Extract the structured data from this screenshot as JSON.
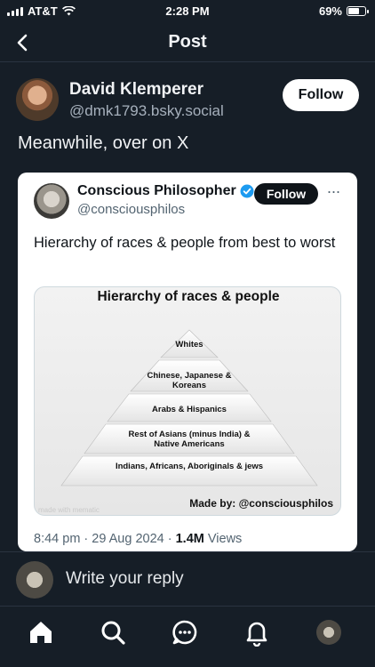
{
  "status_bar": {
    "carrier": "AT&T",
    "time": "2:28 PM",
    "battery": "69%"
  },
  "header": {
    "title": "Post"
  },
  "post": {
    "author_name": "David Klemperer",
    "author_handle": "@dmk1793.bsky.social",
    "follow_label": "Follow",
    "text": "Meanwhile, over on X"
  },
  "quoted": {
    "name": "Conscious Philosopher",
    "handle": "@consciousphilos",
    "follow_label": "Follow",
    "more": "···",
    "text": "Hierarchy of races & people from best to worst",
    "image": {
      "title": "Hierarchy of races & people",
      "tiers": [
        "Whites",
        "Chinese, Japanese & Koreans",
        "Arabs & Hispanics",
        "Rest of Asians (minus India) & Native Americans",
        "Indians, Africans, Aboriginals & jews"
      ],
      "made_by": "Made by: @consciousphilos",
      "watermark": "made with mematic"
    },
    "timestamp": "8:44 pm · 29 Aug 2024 ·",
    "views_count": "1.4M",
    "views_label": "Views"
  },
  "reply": {
    "placeholder": "Write your reply"
  },
  "tabs": [
    {
      "icon": "home-icon"
    },
    {
      "icon": "search-icon"
    },
    {
      "icon": "chat-icon"
    },
    {
      "icon": "bell-icon"
    },
    {
      "icon": "profile-avatar"
    }
  ]
}
